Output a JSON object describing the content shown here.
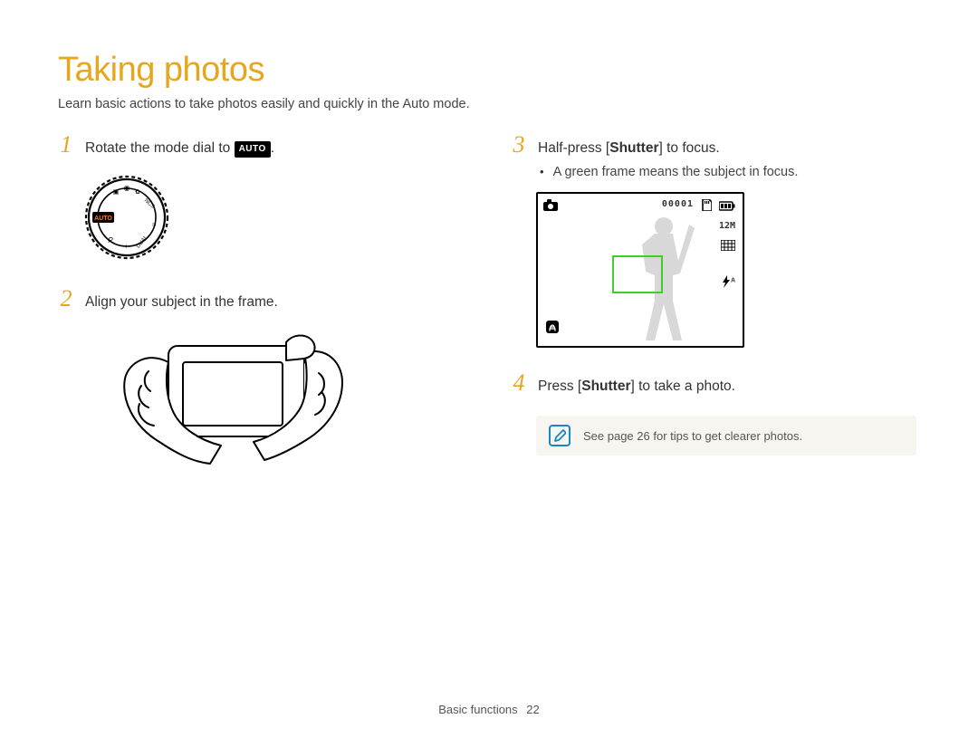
{
  "title": "Taking photos",
  "intro": "Learn basic actions to take photos easily and quickly in the Auto mode.",
  "auto_badge": "AUTO",
  "steps": {
    "s1": {
      "num": "1",
      "text_before": "Rotate the mode dial to ",
      "text_after": "."
    },
    "s2": {
      "num": "2",
      "text": "Align your subject in the frame."
    },
    "s3": {
      "num": "3",
      "text_before": "Half-press [",
      "bold": "Shutter",
      "text_after": "] to focus."
    },
    "s3_bullet": "A green frame means the subject in focus.",
    "s4": {
      "num": "4",
      "text_before": "Press [",
      "bold": "Shutter",
      "text_after": "] to take a photo."
    }
  },
  "lcd": {
    "counter": "00001",
    "resolution": "12M",
    "flash_label": "A"
  },
  "tip": "See page 26 for tips to get clearer photos.",
  "footer_section": "Basic functions",
  "footer_page": "22"
}
